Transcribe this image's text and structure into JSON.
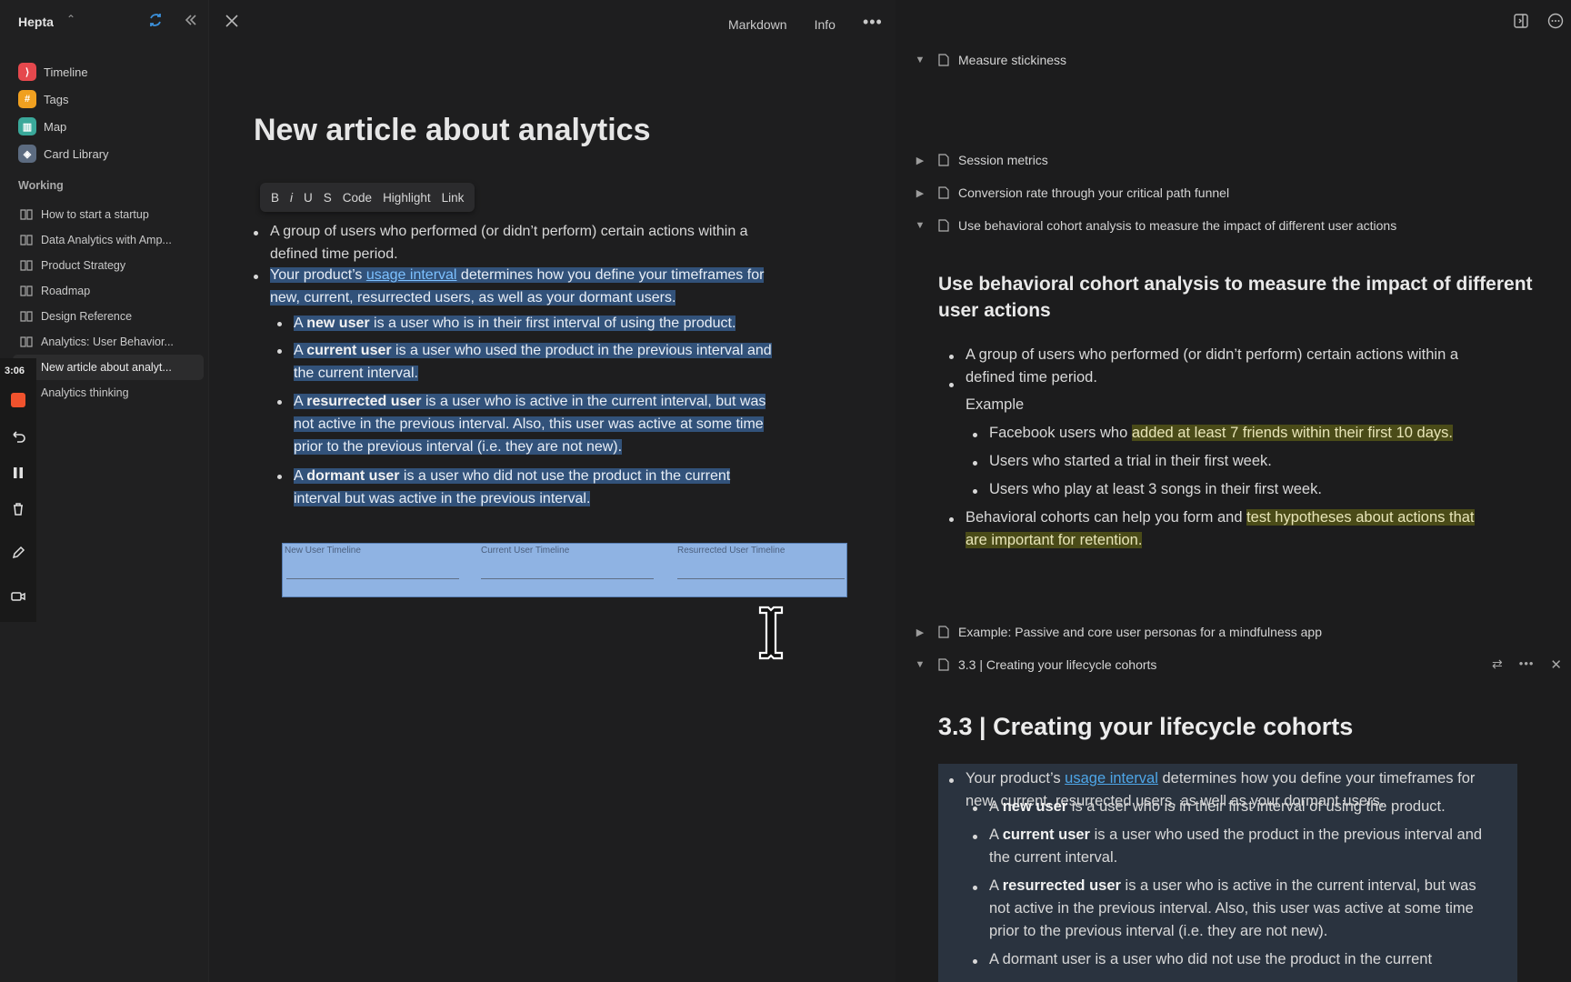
{
  "sidebar": {
    "app_name": "Hepta",
    "nav": [
      {
        "label": "Timeline",
        "icon": "timeline-icon",
        "color": "#e5484d",
        "glyph": "⟩"
      },
      {
        "label": "Tags",
        "icon": "tag-icon",
        "color": "#f0a020",
        "glyph": "#"
      },
      {
        "label": "Map",
        "icon": "map-icon",
        "color": "#3aa89a",
        "glyph": "▥"
      },
      {
        "label": "Card Library",
        "icon": "card-library-icon",
        "color": "#5c6b80",
        "glyph": "◈"
      }
    ],
    "section_title": "Working",
    "docs": [
      {
        "label": "How to start a startup"
      },
      {
        "label": "Data Analytics with Amp..."
      },
      {
        "label": "Product Strategy"
      },
      {
        "label": "Roadmap"
      },
      {
        "label": "Design Reference"
      },
      {
        "label": "Analytics: User Behavior..."
      },
      {
        "label": "New article about analyt..."
      },
      {
        "label": "Analytics thinking"
      }
    ]
  },
  "recorder": {
    "time": "3:06"
  },
  "topbar": {
    "markdown": "Markdown",
    "info": "Info"
  },
  "editor": {
    "title": "New article about analytics",
    "toolbar": [
      "B",
      "i",
      "U",
      "S",
      "Code",
      "Highlight",
      "Link"
    ],
    "p1": "A group of users who performed (or didn’t perform) certain actions within a",
    "p1b": "defined time period.",
    "p2a": "Your product’s ",
    "p2_link": "usage interval",
    "p2b": " determines how you define your timeframes for",
    "p2c": "new, current, resurrected users, as well as your dormant users.",
    "new_a": "A ",
    "new_b": "new user",
    "new_c": " is a user who is in their first interval of using the product.",
    "cur_a": "A ",
    "cur_b": "current user",
    "cur_c": " is a user who used the product in the previous interval and",
    "cur_d": "the current interval.",
    "res_a": "A ",
    "res_b": "resurrected user",
    "res_c": " is a user who is active in the current interval, but was",
    "res_d": "not active in the previous interval. Also, this user was active at some time",
    "res_e": "prior to the previous interval (i.e. they are not new).",
    "dor_a": "A ",
    "dor_b": "dormant user",
    "dor_c": " is a user who did not use the product in the current",
    "dor_d": "interval but was active in the previous interval.",
    "timeline_labels": [
      "New User Timeline",
      "Current User Timeline",
      "Resurrected User Timeline"
    ]
  },
  "right": {
    "outline": [
      {
        "label": "Measure stickiness",
        "expanded": true
      },
      {
        "label": "Session metrics",
        "expanded": false
      },
      {
        "label": "Conversion rate through your critical path funnel",
        "expanded": false
      },
      {
        "label": "Use behavioral cohort analysis to measure the impact of different user actions",
        "expanded": true
      },
      {
        "label": "Example: Passive and core user personas for a mindfulness app",
        "expanded": false
      },
      {
        "label": "3.3 | Creating your lifecycle cohorts",
        "expanded": true
      }
    ],
    "cohort_title_1": "Use behavioral cohort analysis to measure the impact of different",
    "cohort_title_2": "user actions",
    "c1a": "A group of users who performed (or didn’t perform) certain actions within a",
    "c1b": "defined time period.",
    "c2": "Example",
    "c3a": "Facebook users who ",
    "c3_hl": "added at least 7 friends within their first 10 days.",
    "c4": "Users who started a trial in their first week.",
    "c5": "Users who play at least 3 songs in their first week.",
    "c6a": "Behavioral cohorts can help you form and ",
    "c6_hl": "test hypotheses about actions that",
    "c6_hl2": "are important for retention.",
    "lifecycle_title": "3.3 | Creating your lifecycle cohorts",
    "l1a": "Your product’s ",
    "l1_link": "usage interval",
    "l1b": " determines how you define your timeframes for",
    "l1c": "new, current, resurrected users, as well as your dormant users.",
    "l2a": "A ",
    "l2b": "new user",
    "l2c": " is a user who is in their first interval of using the product.",
    "l3a": "A ",
    "l3b": "current user",
    "l3c": " is a user who used the product in the previous interval and",
    "l3d": "the current interval.",
    "l4a": "A ",
    "l4b": "resurrected user",
    "l4c": " is a user who is active in the current interval, but was",
    "l4d": "not active in the previous interval. Also, this user was active at some time",
    "l4e": "prior to the previous interval (i.e. they are not new).",
    "l5": "A dormant user is a user who did not use the product in the current"
  }
}
